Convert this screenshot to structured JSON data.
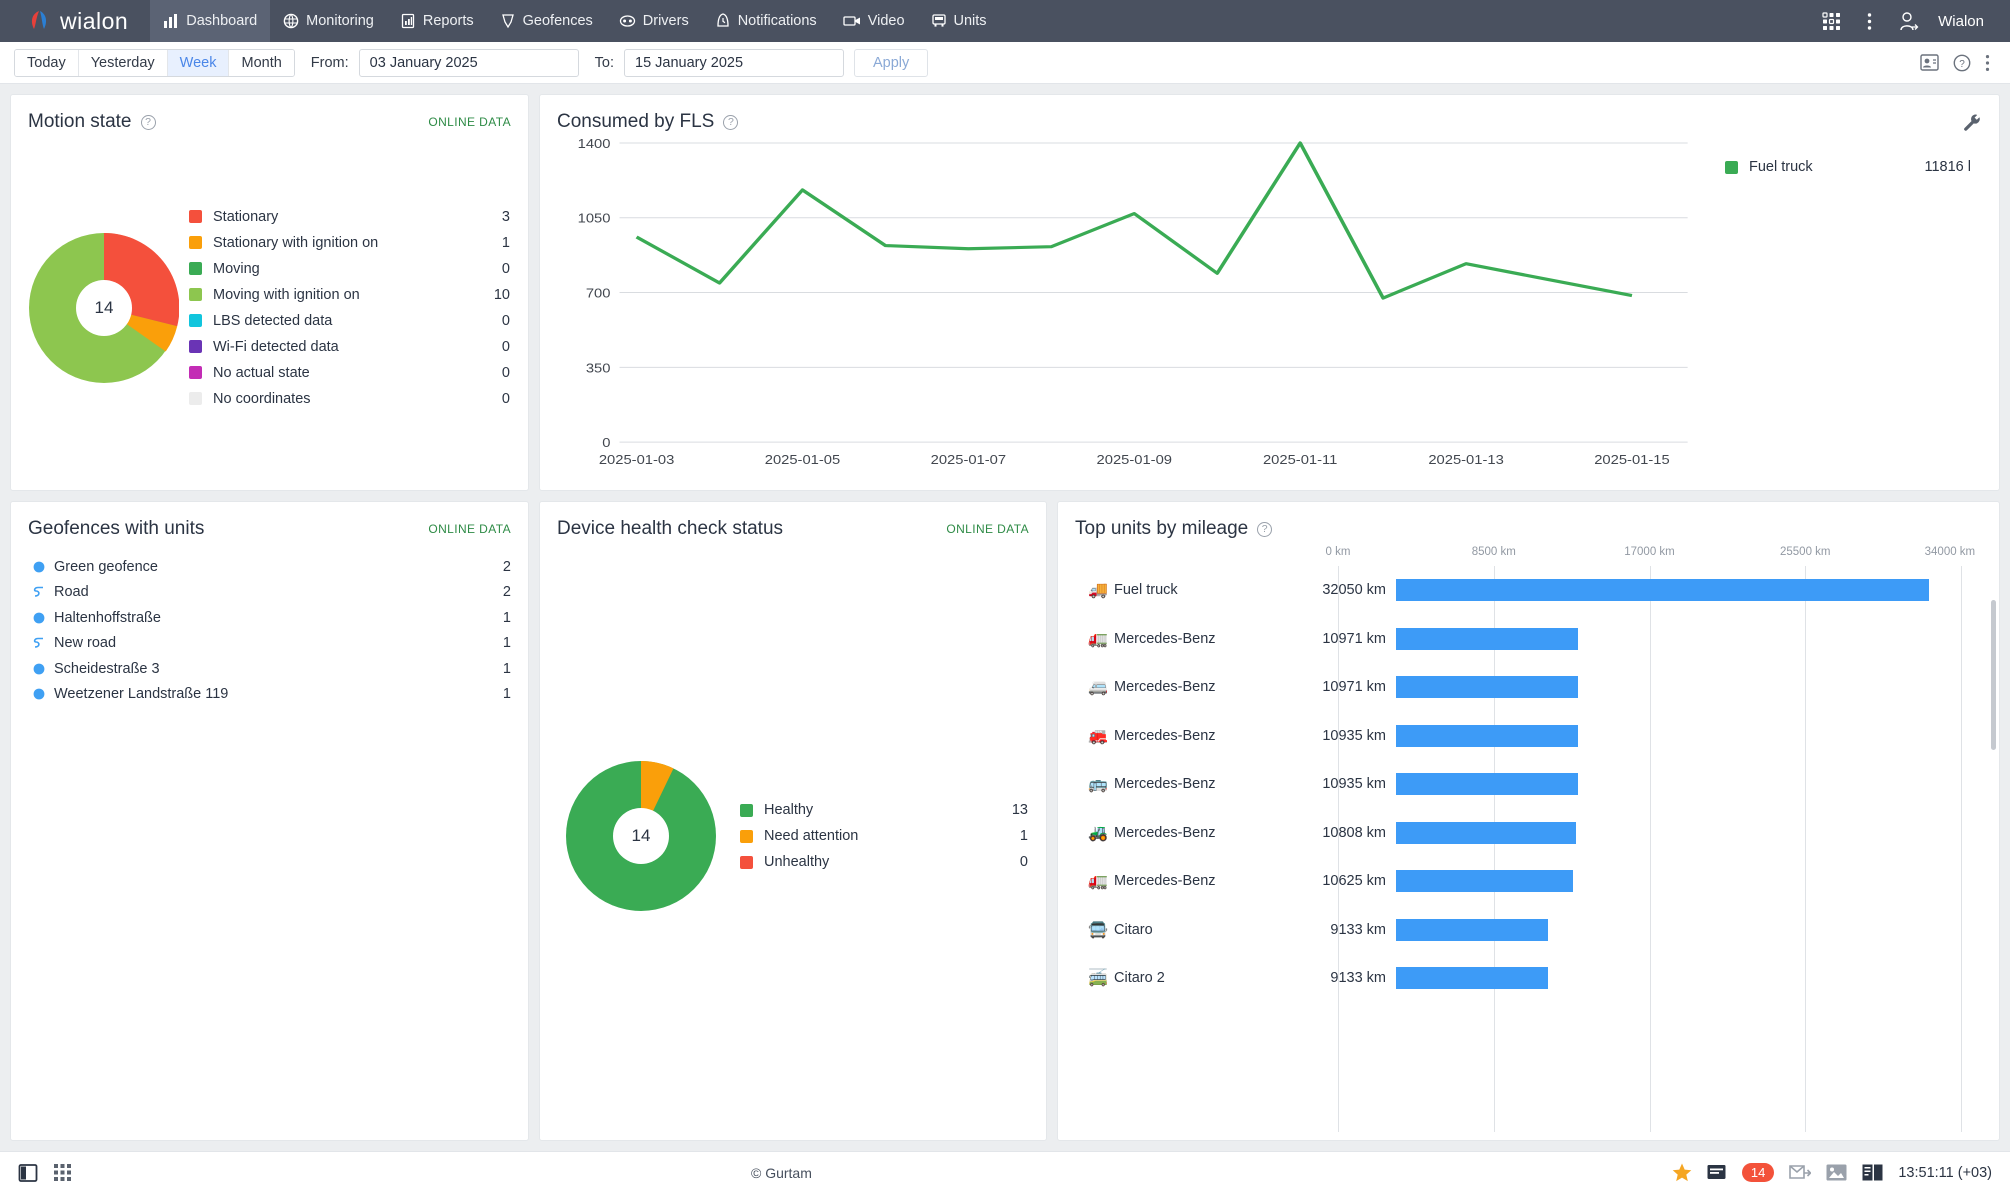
{
  "app": {
    "brand": "wialon",
    "user": "Wialon"
  },
  "nav": {
    "items": [
      {
        "label": "Dashboard",
        "icon": "bar-chart-icon",
        "active": true
      },
      {
        "label": "Monitoring",
        "icon": "globe-icon",
        "active": false
      },
      {
        "label": "Reports",
        "icon": "report-icon",
        "active": false
      },
      {
        "label": "Geofences",
        "icon": "geofence-icon",
        "active": false
      },
      {
        "label": "Drivers",
        "icon": "driver-icon",
        "active": false
      },
      {
        "label": "Notifications",
        "icon": "bell-clock-icon",
        "active": false
      },
      {
        "label": "Video",
        "icon": "video-icon",
        "active": false
      },
      {
        "label": "Units",
        "icon": "unit-bus-icon",
        "active": false
      }
    ],
    "right": [
      {
        "icon": "apps-grid-icon"
      },
      {
        "icon": "kebab-menu-icon"
      },
      {
        "icon": "user-logout-icon"
      }
    ]
  },
  "toolbar": {
    "ranges": [
      {
        "label": "Today",
        "active": false
      },
      {
        "label": "Yesterday",
        "active": false
      },
      {
        "label": "Week",
        "active": true
      },
      {
        "label": "Month",
        "active": false
      }
    ],
    "from_label": "From:",
    "from_value": "03 January 2025",
    "to_label": "To:",
    "to_value": "15 January 2025",
    "apply_label": "Apply",
    "right_icons": [
      {
        "icon": "contacts-icon"
      },
      {
        "icon": "help-circle-icon"
      },
      {
        "icon": "kebab-menu-icon"
      }
    ]
  },
  "motion_state": {
    "title": "Motion state",
    "badge": "ONLINE DATA",
    "center_total": "14",
    "legend": [
      {
        "label": "Stationary",
        "value": "3",
        "color": "#f4503c"
      },
      {
        "label": "Stationary with ignition on",
        "value": "1",
        "color": "#fa9f0a"
      },
      {
        "label": "Moving",
        "value": "0",
        "color": "#3aab54"
      },
      {
        "label": "Moving with ignition on",
        "value": "10",
        "color": "#8dc64f"
      },
      {
        "label": "LBS detected data",
        "value": "0",
        "color": "#11c5dd"
      },
      {
        "label": "Wi-Fi detected data",
        "value": "0",
        "color": "#6a34b5"
      },
      {
        "label": "No actual state",
        "value": "0",
        "color": "#c32cb5"
      },
      {
        "label": "No coordinates",
        "value": "0",
        "color": "#ececec"
      }
    ]
  },
  "consumed_by_fls": {
    "title": "Consumed by FLS",
    "settings_icon": "wrench-icon",
    "legend": [
      {
        "label": "Fuel truck",
        "value": "11816 l",
        "color": "#3aab54"
      }
    ]
  },
  "geofences": {
    "title": "Geofences with units",
    "badge": "ONLINE DATA",
    "items": [
      {
        "name": "Green geofence",
        "value": "2",
        "icon": "circle-geofence-icon"
      },
      {
        "name": "Road",
        "value": "2",
        "icon": "line-geofence-icon"
      },
      {
        "name": "Haltenhoffstraße",
        "value": "1",
        "icon": "circle-geofence-icon"
      },
      {
        "name": "New road",
        "value": "1",
        "icon": "line-geofence-icon"
      },
      {
        "name": "Scheidestraße 3",
        "value": "1",
        "icon": "circle-geofence-icon"
      },
      {
        "name": "Weetzener Landstraße 119",
        "value": "1",
        "icon": "circle-geofence-icon"
      }
    ]
  },
  "device_health": {
    "title": "Device health check status",
    "badge": "ONLINE DATA",
    "center_total": "14",
    "legend": [
      {
        "label": "Healthy",
        "value": "13",
        "color": "#3aab54"
      },
      {
        "label": "Need attention",
        "value": "1",
        "color": "#fa9f0a"
      },
      {
        "label": "Unhealthy",
        "value": "0",
        "color": "#f4503c"
      }
    ]
  },
  "top_units": {
    "title": "Top units by mileage",
    "axis_ticks": [
      "0 km",
      "8500 km",
      "17000 km",
      "25500 km",
      "34000 km"
    ],
    "rows": [
      {
        "name": "Fuel truck",
        "value": "32050 km",
        "icon": "truck-dark-icon"
      },
      {
        "name": "Mercedes-Benz",
        "value": "10971 km",
        "icon": "truck-yellow-icon"
      },
      {
        "name": "Mercedes-Benz",
        "value": "10971 km",
        "icon": "truck-green-icon"
      },
      {
        "name": "Mercedes-Benz",
        "value": "10935 km",
        "icon": "truck-red-icon"
      },
      {
        "name": "Mercedes-Benz",
        "value": "10935 km",
        "icon": "truck-green2-icon"
      },
      {
        "name": "Mercedes-Benz",
        "value": "10808 km",
        "icon": "truck-tan-icon"
      },
      {
        "name": "Mercedes-Benz",
        "value": "10625 km",
        "icon": "truck-red2-icon"
      },
      {
        "name": "Citaro",
        "value": "9133 km",
        "icon": "bus-yellow-icon"
      },
      {
        "name": "Citaro 2",
        "value": "9133 km",
        "icon": "bus-dark-icon"
      }
    ]
  },
  "statusbar": {
    "left_icons": [
      {
        "icon": "panel-toggle-icon"
      },
      {
        "icon": "apps-grid-icon"
      }
    ],
    "copyright": "© Gurtam",
    "right_icons": [
      {
        "icon": "star-icon"
      },
      {
        "icon": "messages-icon"
      },
      {
        "icon": "mail-forward-icon"
      },
      {
        "icon": "image-icon"
      },
      {
        "icon": "layout-icon"
      }
    ],
    "notifications_count": "14",
    "time": "13:51:11 (+03)"
  },
  "chart_data": [
    {
      "type": "pie",
      "name": "motion-state-donut",
      "title": "Motion state",
      "labels": [
        "Stationary",
        "Stationary with ignition on",
        "Moving",
        "Moving with ignition on",
        "LBS detected data",
        "Wi-Fi detected data",
        "No actual state",
        "No coordinates"
      ],
      "values": [
        3,
        1,
        0,
        10,
        0,
        0,
        0,
        0
      ],
      "colors": [
        "#f4503c",
        "#fa9f0a",
        "#3aab54",
        "#8dc64f",
        "#11c5dd",
        "#6a34b5",
        "#c32cb5",
        "#ececec"
      ],
      "total": 14,
      "legend": "right"
    },
    {
      "type": "line",
      "name": "consumed-by-fls",
      "title": "Consumed by FLS",
      "xlabel": "",
      "ylabel": "",
      "ylim": [
        0,
        1400
      ],
      "yticks": [
        0,
        350,
        700,
        1050,
        1400
      ],
      "grid": true,
      "legend": "right",
      "x": [
        "2025-01-03",
        "2025-01-04",
        "2025-01-05",
        "2025-01-06",
        "2025-01-07",
        "2025-01-08",
        "2025-01-09",
        "2025-01-10",
        "2025-01-11",
        "2025-01-12",
        "2025-01-13",
        "2025-01-14",
        "2025-01-15"
      ],
      "xtick_labels": [
        "2025-01-03",
        "2025-01-05",
        "2025-01-07",
        "2025-01-09",
        "2025-01-11",
        "2025-01-13",
        "2025-01-15"
      ],
      "series": [
        {
          "name": "Fuel truck",
          "color": "#3aab54",
          "total": "11816 l",
          "values": [
            960,
            745,
            1180,
            920,
            905,
            915,
            1070,
            790,
            1400,
            675,
            835,
            760,
            685
          ]
        }
      ]
    },
    {
      "type": "pie",
      "name": "device-health-donut",
      "title": "Device health check status",
      "labels": [
        "Healthy",
        "Need attention",
        "Unhealthy"
      ],
      "values": [
        13,
        1,
        0
      ],
      "colors": [
        "#3aab54",
        "#fa9f0a",
        "#f4503c"
      ],
      "total": 14,
      "legend": "right"
    },
    {
      "type": "bar",
      "name": "top-units-by-mileage",
      "title": "Top units by mileage",
      "orientation": "horizontal",
      "xlabel": "km",
      "xlim": [
        0,
        34000
      ],
      "xticks": [
        0,
        8500,
        17000,
        25500,
        34000
      ],
      "categories": [
        "Fuel truck",
        "Mercedes-Benz",
        "Mercedes-Benz",
        "Mercedes-Benz",
        "Mercedes-Benz",
        "Mercedes-Benz",
        "Mercedes-Benz",
        "Citaro",
        "Citaro 2"
      ],
      "values": [
        32050,
        10971,
        10971,
        10935,
        10935,
        10808,
        10625,
        9133,
        9133
      ],
      "color": "#3d9bf7"
    }
  ]
}
